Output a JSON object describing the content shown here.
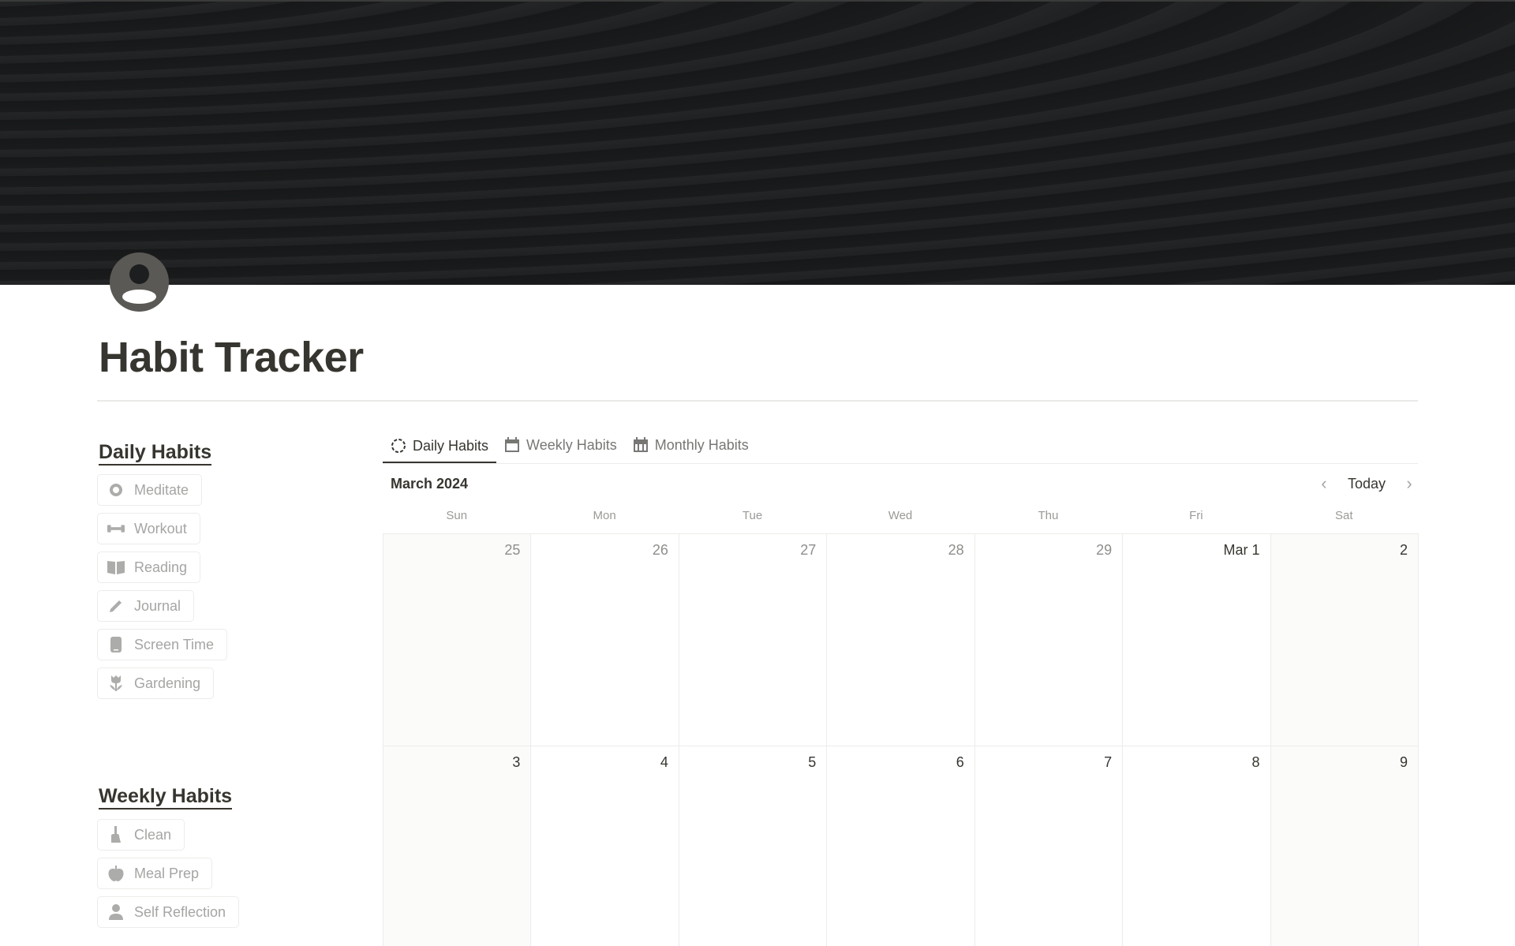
{
  "page": {
    "title": "Habit Tracker",
    "avatar_icon": "user-circle-icon"
  },
  "daily_habits": {
    "heading": "Daily Habits",
    "items": [
      {
        "label": "Meditate",
        "icon": "circle-icon"
      },
      {
        "label": "Workout",
        "icon": "dumbbell-icon"
      },
      {
        "label": "Reading",
        "icon": "book-icon"
      },
      {
        "label": "Journal",
        "icon": "pencil-icon"
      },
      {
        "label": "Screen Time",
        "icon": "phone-icon"
      },
      {
        "label": "Gardening",
        "icon": "flower-icon"
      }
    ]
  },
  "weekly_habits": {
    "heading": "Weekly Habits",
    "items": [
      {
        "label": "Clean",
        "icon": "broom-icon"
      },
      {
        "label": "Meal Prep",
        "icon": "apple-icon"
      },
      {
        "label": "Self Reflection",
        "icon": "person-icon"
      }
    ]
  },
  "calendar": {
    "tabs": [
      {
        "label": "Daily Habits",
        "icon": "dashed-circle-icon",
        "active": true
      },
      {
        "label": "Weekly Habits",
        "icon": "calendar-icon",
        "active": false
      },
      {
        "label": "Monthly Habits",
        "icon": "calendar-grid-icon",
        "active": false
      }
    ],
    "month_label": "March 2024",
    "today_label": "Today",
    "weekdays": [
      "Sun",
      "Mon",
      "Tue",
      "Wed",
      "Thu",
      "Fri",
      "Sat"
    ],
    "weeks": [
      [
        "25",
        "26",
        "27",
        "28",
        "29",
        "Mar 1",
        "2"
      ],
      [
        "3",
        "4",
        "5",
        "6",
        "7",
        "8",
        "9"
      ]
    ]
  }
}
